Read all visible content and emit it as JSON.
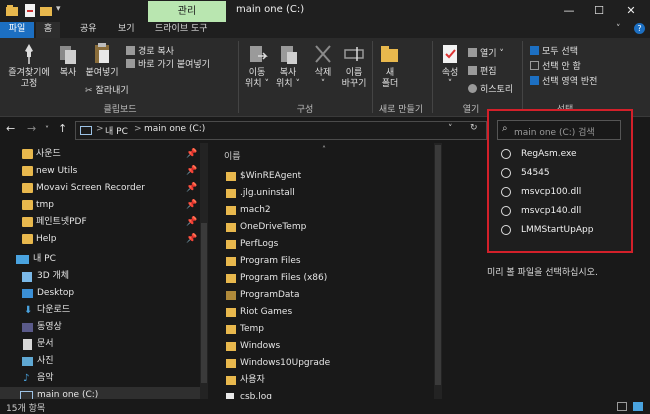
{
  "window": {
    "title": "main one (C:)",
    "manage_tab": "관리",
    "controls": {
      "minimize": "—",
      "maximize": "☐",
      "close": "✕"
    }
  },
  "ribbon_tabs": [
    "파일",
    "홈",
    "공유",
    "보기",
    "드라이브 도구"
  ],
  "ribbon": {
    "clipboard": {
      "pin_quick_access": [
        "즐겨찾기에",
        "고정"
      ],
      "copy": "복사",
      "paste": "붙여넣기",
      "copy_path": "경로 복사",
      "paste_shortcut": "바로 가기 붙여넣기",
      "cut": "잘라내기",
      "group_label": "클립보드"
    },
    "organize": {
      "move_to": [
        "이동",
        "위치 ˅"
      ],
      "copy_to": [
        "복사",
        "위치 ˅"
      ],
      "delete": [
        "삭제",
        "˅"
      ],
      "rename": [
        "이름",
        "바꾸기"
      ],
      "group_label": "구성"
    },
    "new": {
      "new_folder": [
        "새",
        "폴더"
      ],
      "group_label": "새로 만들기"
    },
    "open": {
      "properties": [
        "속성",
        "˅"
      ],
      "open": "열기 ˅",
      "edit": "편집",
      "history": "히스토리",
      "group_label": "열기"
    },
    "select": {
      "select_all": "모두 선택",
      "select_none": "선택 안 함",
      "invert_selection": "선택 영역 반전",
      "group_label": "선택"
    }
  },
  "address": {
    "path": [
      "내 PC",
      "main one (C:)"
    ],
    "separator": ">"
  },
  "sidebar": {
    "quick_access": [
      {
        "label": "사운드",
        "pinned": true
      },
      {
        "label": "new Utils",
        "pinned": true
      },
      {
        "label": "Movavi Screen Recorder",
        "pinned": true
      },
      {
        "label": "tmp",
        "pinned": true
      },
      {
        "label": "페인트넷PDF",
        "pinned": true
      },
      {
        "label": "Help",
        "pinned": true
      }
    ],
    "this_pc": "내 PC",
    "pc_items": [
      "3D 개체",
      "Desktop",
      "다운로드",
      "동영상",
      "문서",
      "사진",
      "음악",
      "main one (C:)"
    ]
  },
  "file_list": {
    "column_header": "이름",
    "items": [
      "$WinREAgent",
      ".jlg.uninstall",
      "mach2",
      "OneDriveTemp",
      "PerfLogs",
      "Program Files",
      "Program Files (x86)",
      "ProgramData",
      "Riot Games",
      "Temp",
      "Windows",
      "Windows10Upgrade",
      "사용자",
      "csb.log"
    ]
  },
  "search": {
    "placeholder": "main one (C:) 검색",
    "suggestions": [
      "RegAsm.exe",
      "54545",
      "msvcp100.dll",
      "msvcp140.dll",
      "LMMStartUpApp"
    ]
  },
  "preview_message": "미리 볼 파일을 선택하십시오.",
  "status": {
    "item_count": "15개 항목"
  },
  "colors": {
    "accent": "#1c6fc2",
    "manage_tab": "#b9e6b0",
    "folder": "#e8b84d",
    "highlight_border": "#d3202a"
  }
}
